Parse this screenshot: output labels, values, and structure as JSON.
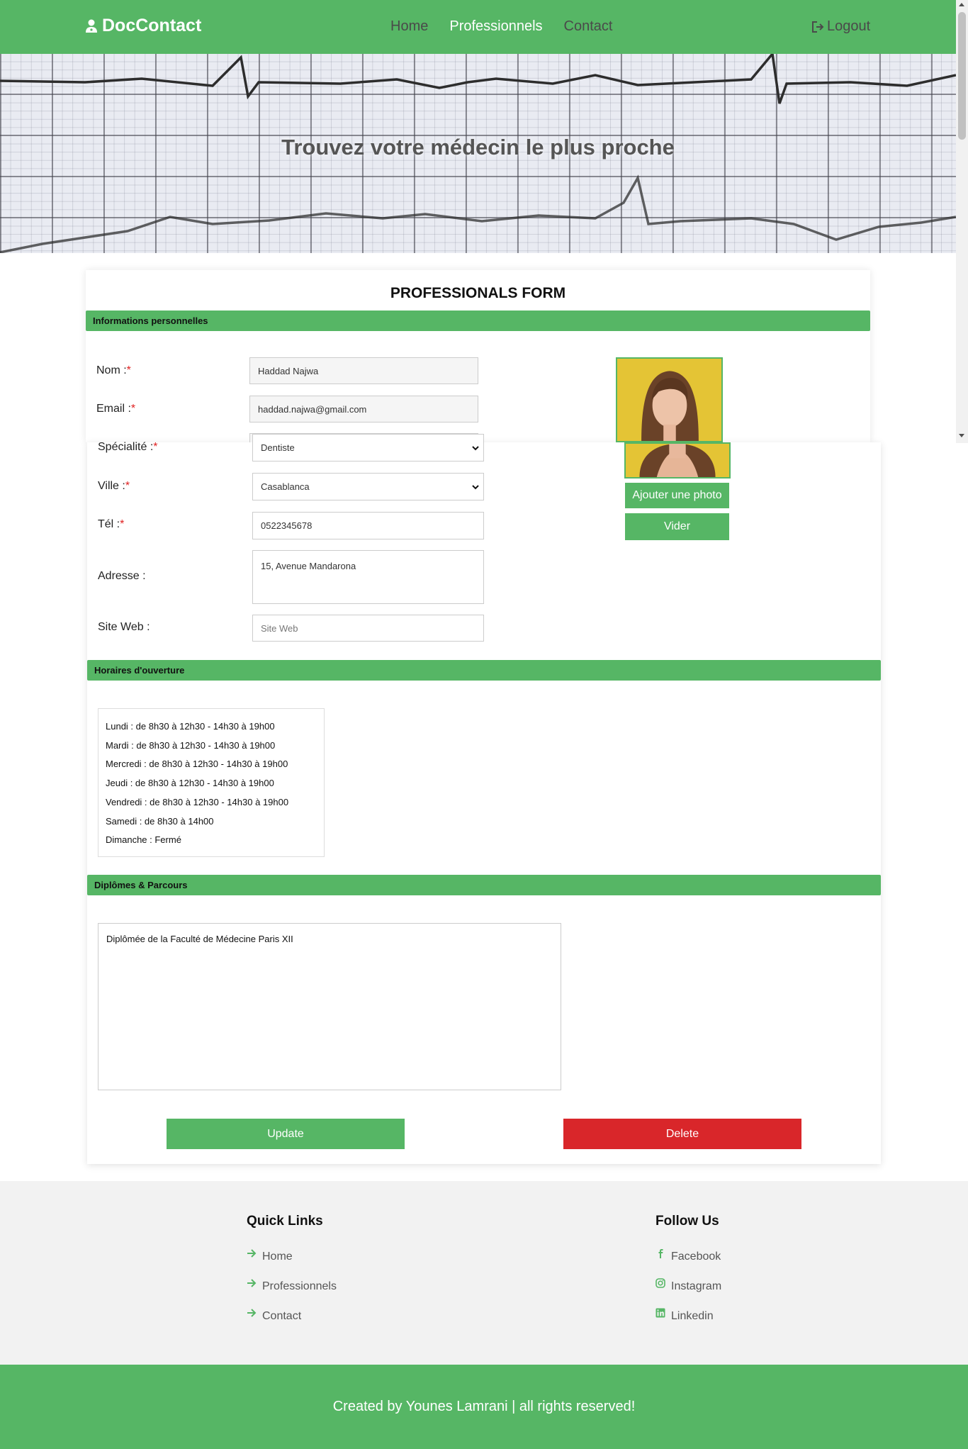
{
  "nav": {
    "brand": "DocContact",
    "links": [
      "Home",
      "Professionnels",
      "Contact"
    ],
    "logout": "Logout"
  },
  "hero": {
    "title": "Trouvez votre médecin le plus proche"
  },
  "form": {
    "title": "PROFESSIONALS FORM",
    "sections": {
      "personal": "Informations personnelles",
      "hours": "Horaires d'ouverture",
      "diplomas": "Diplômes & Parcours"
    },
    "labels": {
      "nom": "Nom :",
      "email": "Email :",
      "specialite": "Spécialité :",
      "ville": "Ville :",
      "tel": "Tél :",
      "adresse": "Adresse :",
      "site": "Site Web :",
      "required_mark": "*"
    },
    "values": {
      "nom": "Haddad Najwa",
      "email": "haddad.najwa@gmail.com",
      "specialite": "Dentiste",
      "ville": "Casablanca",
      "tel": "0522345678",
      "adresse": "15, Avenue Mandarona",
      "site_placeholder": "Site Web"
    },
    "photo_buttons": {
      "add": "Ajouter une photo",
      "clear": "Vider"
    },
    "hours": [
      "Lundi : de 8h30 à 12h30 - 14h30 à 19h00",
      "Mardi : de 8h30 à 12h30 - 14h30 à 19h00",
      "Mercredi : de 8h30 à 12h30 - 14h30 à 19h00",
      "Jeudi : de 8h30 à 12h30 - 14h30 à 19h00",
      "Vendredi : de 8h30 à 12h30 - 14h30 à 19h00",
      "Samedi : de 8h30 à 14h00",
      "Dimanche : Fermé"
    ],
    "diplomas": "Diplômée de la Faculté de Médecine Paris XII",
    "actions": {
      "update": "Update",
      "delete": "Delete"
    }
  },
  "footer": {
    "quick_links_title": "Quick Links",
    "quick_links": [
      "Home",
      "Professionnels",
      "Contact"
    ],
    "follow_title": "Follow Us",
    "social": [
      "Facebook",
      "Instagram",
      "Linkedin"
    ],
    "copyright": "Created by Younes Lamrani | all rights reserved!"
  },
  "colors": {
    "primary": "#56b665",
    "danger": "#d9262a",
    "footer_bg": "#f2f2f2"
  },
  "icons": [
    "user-doctor-icon",
    "logout-icon",
    "chevron-down-icon",
    "arrow-right-icon",
    "facebook-icon",
    "instagram-icon",
    "linkedin-icon"
  ]
}
